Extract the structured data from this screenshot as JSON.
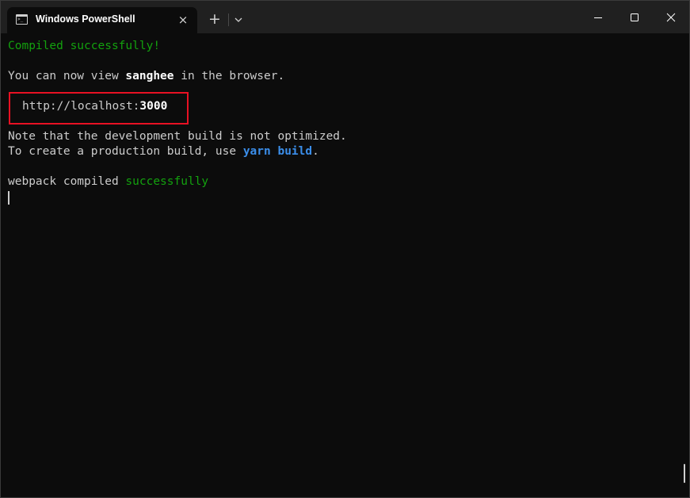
{
  "window": {
    "tab_title": "Windows PowerShell",
    "tab_icon": "terminal-icon",
    "tab_close": "×",
    "new_tab": "+",
    "icons": [
      "close-icon",
      "plus-icon",
      "chevron-down-icon",
      "minimize-icon",
      "maximize-icon",
      "close-icon"
    ]
  },
  "terminal": {
    "line1": "Compiled successfully!",
    "line2_prefix": "You can now view ",
    "line2_app": "sanghee",
    "line2_suffix": " in the browser.",
    "url_prefix": "http://localhost:",
    "url_port": "3000",
    "note1": "Note that the development build is not optimized.",
    "note2_prefix": "To create a production build, use ",
    "note2_cmd": "yarn build",
    "note2_suffix": ".",
    "webpack_prefix": "webpack compiled ",
    "webpack_status": "successfully"
  },
  "colors": {
    "background": "#0c0c0c",
    "titlebar": "#202020",
    "success_green": "#13a10e",
    "command_blue": "#3b8eea",
    "highlight_red": "#e81123",
    "text": "#cccccc"
  }
}
